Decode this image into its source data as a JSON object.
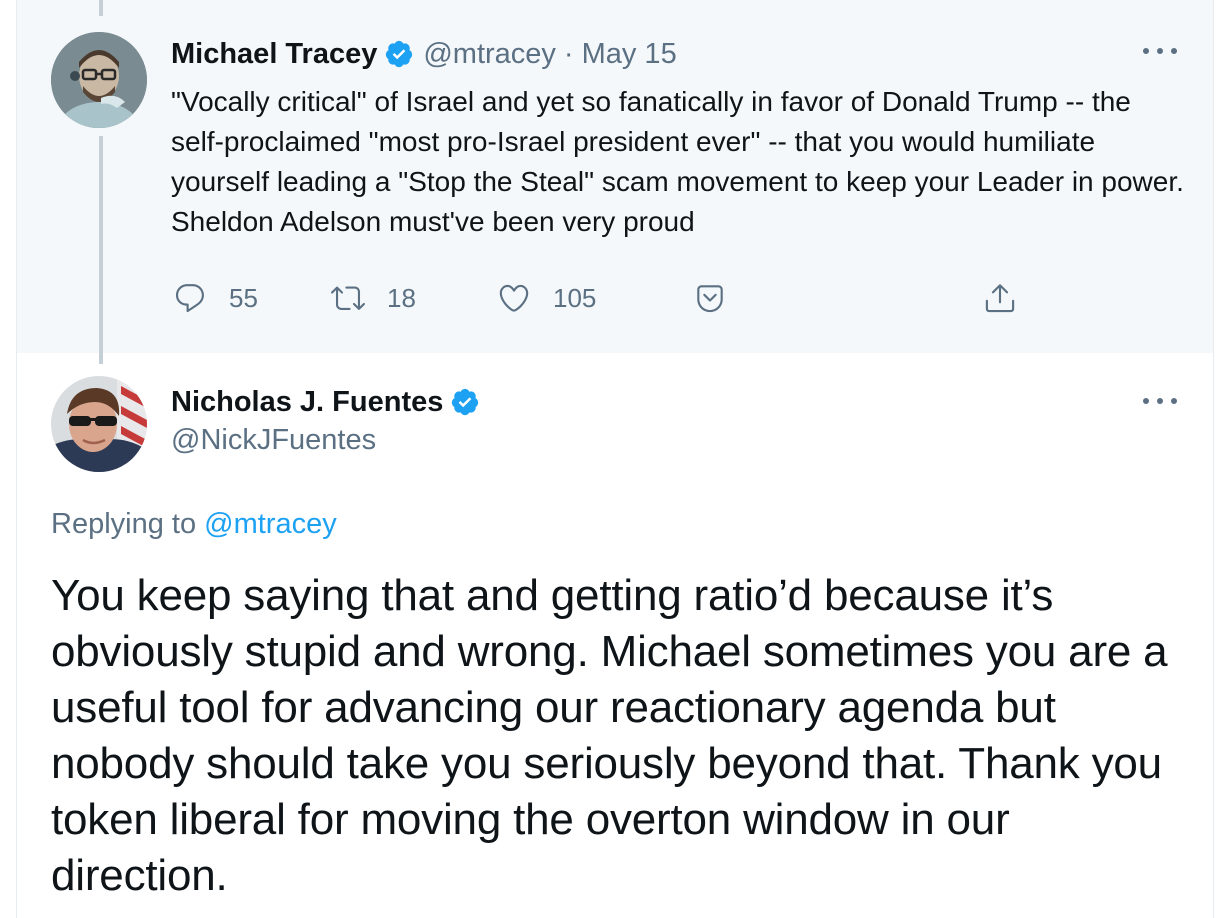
{
  "parent_tweet": {
    "author_name": "Michael Tracey",
    "handle": "@mtracey",
    "separator": "·",
    "date": "May 15",
    "verified": true,
    "text": "\"Vocally critical\" of Israel and yet so fanatically in favor of Donald Trump -- the self-proclaimed \"most pro-Israel president ever\" -- that you would humiliate yourself leading a \"Stop the Steal\" scam movement to keep your Leader in power. Sheldon Adelson must've been very proud",
    "actions": {
      "reply_count": "55",
      "retweet_count": "18",
      "like_count": "105"
    }
  },
  "main_tweet": {
    "author_name": "Nicholas J. Fuentes",
    "handle": "@NickJFuentes",
    "verified": true,
    "replying_prefix": "Replying to",
    "replying_to": "@mtracey",
    "text": "You keep saying that and getting ratio’d because it’s obviously stupid and wrong. Michael sometimes you are a useful tool for advancing our reactionary agenda but nobody should take you seriously beyond that. Thank you token liberal for moving the overton window in our direction."
  },
  "icons": {
    "reply": "reply-icon",
    "retweet": "retweet-icon",
    "like": "heart-icon",
    "save": "save-icon",
    "share": "share-icon",
    "verified": "verified-badge-icon",
    "more": "more-options-icon"
  },
  "colors": {
    "accent": "#1da1f2",
    "secondary_text": "#5b7083",
    "highlight_bg": "#f5f8fa",
    "thread_line": "#c4cfd6"
  }
}
